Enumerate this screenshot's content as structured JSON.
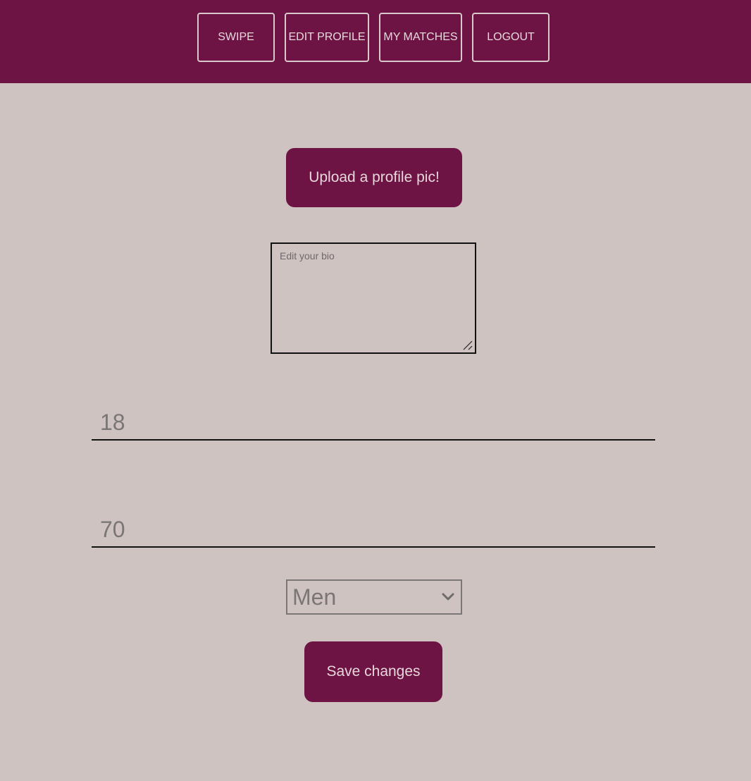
{
  "nav": {
    "swipe": "SWIPE",
    "edit_profile": "EDIT PROFILE",
    "my_matches": "MY MATCHES",
    "logout": "LOGOUT"
  },
  "profile": {
    "upload_label": "Upload a profile pic!",
    "bio_placeholder": "Edit your bio",
    "age_min_placeholder": "18",
    "age_max_placeholder": "70",
    "gender_pref_value": "Men",
    "save_label": "Save changes"
  },
  "colors": {
    "brand": "#6e1445",
    "background": "#cfc3c2"
  }
}
